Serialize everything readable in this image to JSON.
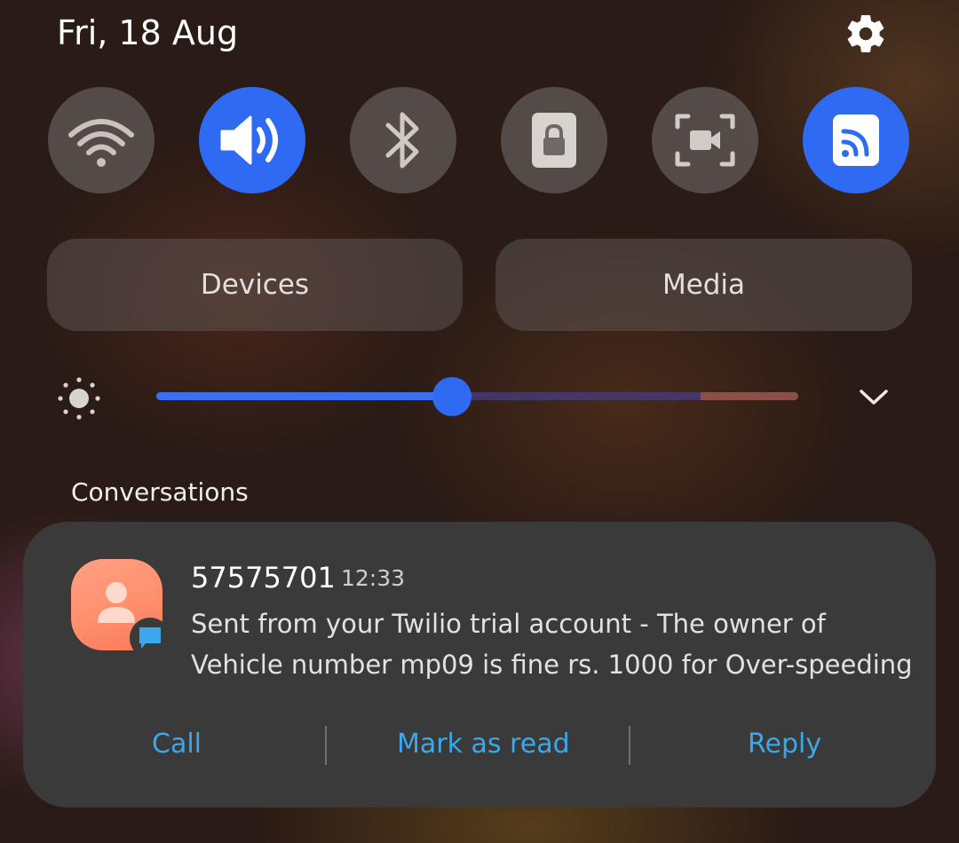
{
  "status": {
    "date": "Fri, 18 Aug",
    "settings_icon": "gear-icon"
  },
  "quick_settings": {
    "accent_color": "#2f6bf2",
    "toggles": [
      {
        "icon": "wifi-icon",
        "state": "off"
      },
      {
        "icon": "sound-icon",
        "state": "on"
      },
      {
        "icon": "bluetooth-icon",
        "state": "off"
      },
      {
        "icon": "portrait-lock-icon",
        "state": "off"
      },
      {
        "icon": "screen-recorder-icon",
        "state": "off"
      },
      {
        "icon": "cast-icon",
        "state": "on"
      }
    ],
    "devices_label": "Devices",
    "media_label": "Media"
  },
  "brightness": {
    "level": 0.46,
    "sun_icon": "brightness-icon",
    "expand_icon": "chevron-down-icon"
  },
  "conversations": {
    "section_label": "Conversations",
    "notification": {
      "sender": "57575701",
      "time": "12:33",
      "message": "Sent from your Twilio trial account - The owner of Vehicle number mp09 is fine rs. 1000 for Over-speeding",
      "avatar_icon": "contact-avatar-icon",
      "badge_icon": "message-bubble-icon",
      "actions": {
        "call": "Call",
        "mark_as_read": "Mark as read",
        "reply": "Reply"
      },
      "action_color": "#3aa8ea"
    }
  }
}
